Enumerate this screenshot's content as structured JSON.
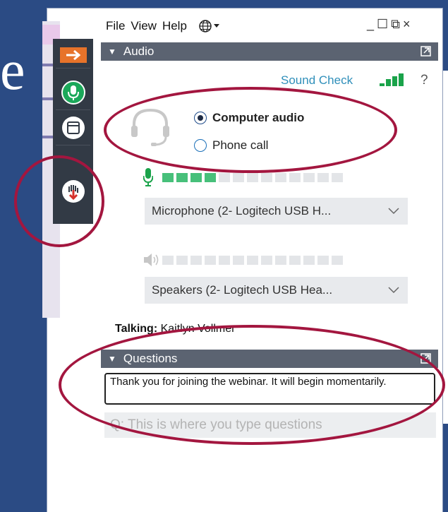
{
  "background": {
    "slide_letter": "e"
  },
  "menu": {
    "file": "File",
    "view": "View",
    "help": "Help"
  },
  "window_controls": {
    "minimize": "_",
    "maximize": "☐",
    "restore": "⧉",
    "close": "×"
  },
  "audio": {
    "header": "Audio",
    "sound_check": "Sound Check",
    "help": "?",
    "options": [
      {
        "label": "Computer audio",
        "selected": true
      },
      {
        "label": "Phone call",
        "selected": false
      }
    ],
    "mic_level": 4,
    "mic_segments": 13,
    "microphone": "Microphone (2- Logitech USB H...",
    "speaker_level": 0,
    "speaker_segments": 13,
    "speakers": "Speakers (2- Logitech USB Hea..."
  },
  "talking": {
    "label": "Talking:",
    "name": "Kaitlyn Vollmer"
  },
  "questions": {
    "header": "Questions",
    "message": "Thank you for joining the webinar. It will begin momentarily.",
    "placeholder": "Q: This is where you type questions"
  },
  "colors": {
    "accent": "#2f8fba",
    "annotation": "#a3163f",
    "header": "#5b6371",
    "meter_on": "#47c07a"
  }
}
